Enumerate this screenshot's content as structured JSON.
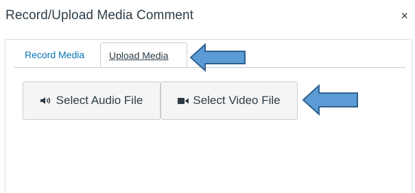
{
  "dialog": {
    "title": "Record/Upload Media Comment",
    "close_label": "×"
  },
  "tabs": [
    {
      "label": "Record Media",
      "selected": false
    },
    {
      "label": "Upload Media",
      "selected": true
    }
  ],
  "buttons": {
    "audio_label": "Select Audio File",
    "video_label": "Select Video File"
  },
  "icons": {
    "audio": "speaker-icon",
    "video": "video-camera-icon",
    "callout": "left-arrow-callout-icon"
  },
  "colors": {
    "link": "#0374b5",
    "text": "#2d3b45",
    "arrow_fill": "#5b9bd5",
    "arrow_stroke": "#2f5f8f",
    "button_bg": "#f5f5f5"
  }
}
